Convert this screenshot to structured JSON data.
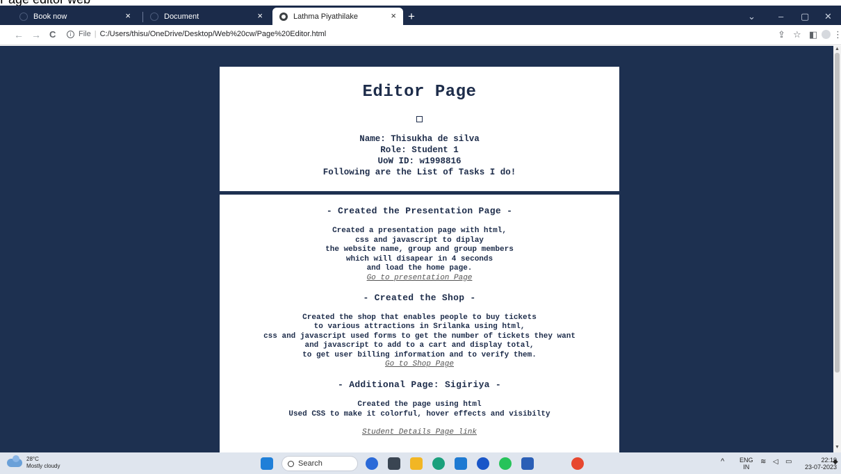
{
  "caption": "Page editor web",
  "browser": {
    "tabs": [
      {
        "label": "Book now",
        "state": "inactive"
      },
      {
        "label": "Document",
        "state": "inactive"
      },
      {
        "label": "Lathma Piyathilake",
        "state": "active"
      }
    ],
    "new_tab_glyph": "+",
    "close_glyph": "×",
    "window_controls": {
      "chevron": "⌄",
      "minimize": "–",
      "restore": "▢",
      "close": "✕"
    },
    "nav": {
      "back": "←",
      "forward": "→",
      "reload": "C"
    },
    "address": {
      "scheme": "File",
      "url": "C:/Users/thisu/OneDrive/Desktop/Web%20cw/Page%20Editor.html"
    }
  },
  "page": {
    "title": "Editor Page",
    "profile": {
      "name": "Name: Thisukha de silva",
      "role": "Role: Student 1",
      "uow_id": "UoW ID: w1998816",
      "intro": "Following are the List of Tasks I do!"
    },
    "sections": [
      {
        "title": "- Created the Presentation Page -",
        "body": [
          "Created a presentation page with html,",
          "css and javascript to diplay",
          "the website name, group and group members",
          "which will disapear in 4 seconds",
          "and load the home page."
        ],
        "link": "Go to presentation Page"
      },
      {
        "title": "- Created the Shop -",
        "body": [
          "Created the shop that enables people to buy tickets",
          "to various attractions in Srilanka using html,",
          "css and javascript used forms to get the number of tickets they want",
          "and javascript to add to a cart and display total,",
          "to get user billing information and to verify them."
        ],
        "link": "Go to Shop Page"
      },
      {
        "title": "- Additional Page: Sigiriya -",
        "body": [
          "Created the page using html",
          "Used CSS to make it colorful, hover effects and visibilty"
        ],
        "link": ""
      }
    ],
    "footer_link": "Student Details Page link"
  },
  "taskbar": {
    "weather": {
      "temp": "28°C",
      "condition": "Mostly cloudy"
    },
    "search_label": "Search",
    "tray": {
      "lang": "ENG",
      "region": "IN",
      "caret": "^"
    },
    "clock": {
      "time": "22:19",
      "date": "23-07-2023"
    },
    "icons": [
      "windows-start-icon",
      "search-icon",
      "bing-chat-icon",
      "task-view-icon",
      "file-explorer-icon",
      "edge-icon",
      "vscode-icon",
      "cortana-icon",
      "whatsapp-icon",
      "word-icon",
      "chrome-icon"
    ],
    "colors": {
      "start": "#1f7fd8",
      "bing": "#2b6ad8",
      "taskview": "#3a4552",
      "explorer": "#f2b624",
      "edge": "#1aa07c",
      "vscode": "#1e7ad2",
      "cortana": "#1a56c8",
      "whatsapp": "#27c35a",
      "word": "#2b5fb6",
      "chrome": "#e7472f"
    }
  },
  "colors": {
    "page_background": "#1d3050",
    "tab_strip": "#1b2b4a",
    "text_navy": "#1d2c4a"
  }
}
